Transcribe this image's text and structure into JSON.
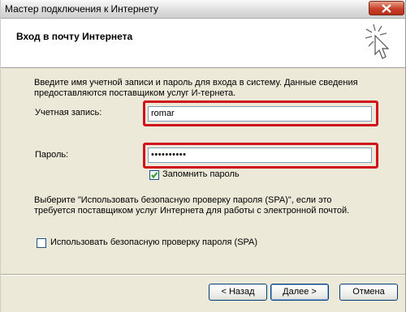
{
  "window": {
    "title": "Мастер подключения к Интернету",
    "close_icon": "close-icon"
  },
  "header": {
    "title": "Вход в почту Интернета",
    "icon": "wizard-sparkle-cursor-icon"
  },
  "intro_text": "Введите имя учетной записи и пароль для входа в систему. Данные сведения предоставляются поставщиком услуг И-тернета.",
  "account": {
    "label": "Учетная запись:",
    "value": "romar"
  },
  "password": {
    "label": "Пароль:",
    "value": "••••••••••",
    "remember_label": "Запомнить пароль",
    "remember_checked": true
  },
  "spa": {
    "text": "Выберите \"Использовать безопасную проверку пароля (SPA)\", если это требуется поставщиком услуг Интернета для работы с электронной почтой.",
    "checkbox_label": "Использовать безопасную проверку пароля (SPA)",
    "checked": false
  },
  "buttons": {
    "back": "< Назад",
    "next": "Далее >",
    "cancel": "Отмена"
  },
  "colors": {
    "highlight": "#d0101a",
    "title_close": "#c8402a",
    "dialog_bg": "#ece9d8"
  }
}
